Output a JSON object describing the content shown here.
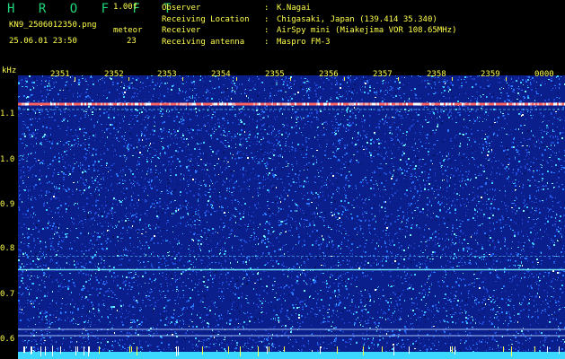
{
  "header": {
    "app_title": "H R O F F T",
    "version": "1.00f",
    "file_name": "KN9_2506012350.png",
    "meteor_label": "meteor",
    "date_time": "25.06.01 23:50",
    "meteor_count": "23",
    "info": [
      {
        "key": "Observer",
        "sep": ":",
        "value": "K.Nagai"
      },
      {
        "key": "Receiving Location",
        "sep": ":",
        "value": "Chigasaki, Japan (139.414 35.340)"
      },
      {
        "key": "Receiver",
        "sep": ":",
        "value": "AirSpy mini (Miakejima VOR 108.65MHz)"
      },
      {
        "key": "Receiving antenna",
        "sep": ":",
        "value": "Maspro FM-3"
      }
    ]
  },
  "axis": {
    "y_unit": "kHz",
    "y_ticks": [
      "1.1",
      "1.0",
      "0.9",
      "0.8",
      "0.7",
      "0.6"
    ],
    "x_ticks": [
      "2351",
      "2352",
      "2353",
      "2354",
      "2355",
      "2356",
      "2357",
      "2358",
      "2359",
      "0000"
    ]
  },
  "spectrogram": {
    "background_color": "#0a1e8c",
    "noise_colors": [
      "#1e46d2",
      "#2878ff",
      "#3cc8ff",
      "#78f0ff",
      "#ffffff",
      "#061460"
    ],
    "lines": [
      {
        "freq_khz": 1.125,
        "color": "#ff6464",
        "style": "carrier"
      },
      {
        "freq_khz": 1.112,
        "color": "#78f0ff",
        "style": "faint"
      },
      {
        "freq_khz": 0.785,
        "color": "#5ad0ff",
        "style": "faint"
      },
      {
        "freq_khz": 0.755,
        "color": "#78f0ff",
        "style": "solid"
      },
      {
        "freq_khz": 0.622,
        "color": "#b4d2ff",
        "style": "thin"
      },
      {
        "freq_khz": 0.608,
        "color": "#b4d2ff",
        "style": "thin"
      }
    ],
    "bottom_band_color": "#3cd8ff"
  }
}
